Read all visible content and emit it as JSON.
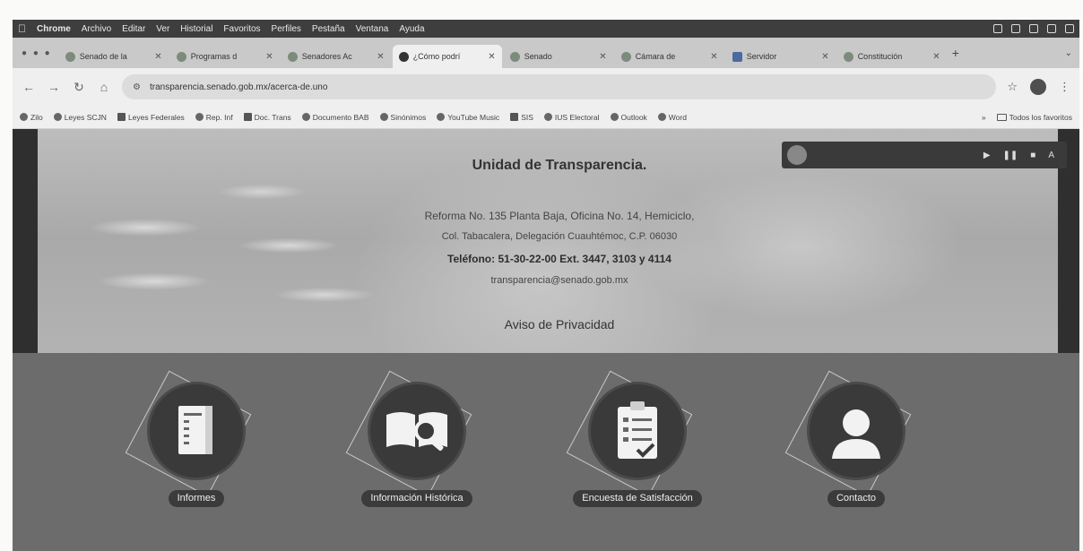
{
  "menubar": {
    "app": "Chrome",
    "items": [
      "Archivo",
      "Editar",
      "Ver",
      "Historial",
      "Favoritos",
      "Perfiles",
      "Pestaña",
      "Ventana",
      "Ayuda"
    ]
  },
  "tabs": [
    {
      "title": "Senado de la",
      "active": false
    },
    {
      "title": "Programas d",
      "active": false
    },
    {
      "title": "Senadores Ac",
      "active": false
    },
    {
      "title": "¿Cómo podrí",
      "active": true
    },
    {
      "title": "Senado",
      "active": false
    },
    {
      "title": "Cámara de",
      "active": false
    },
    {
      "title": "Servidor",
      "active": false
    },
    {
      "title": "Constitución",
      "active": false
    }
  ],
  "address": {
    "url": "transparencia.senado.gob.mx/acerca-de.uno"
  },
  "bookmarks": [
    "Zilo",
    "Leyes SCJN",
    "Leyes Federales",
    "Rep. Inf",
    "Doc. Trans",
    "Documento BAB",
    "Sinónimos",
    "YouTube Music",
    "SIS",
    "IUS Electoral",
    "Outlook",
    "Word"
  ],
  "bookmarks_all_label": "Todos los favoritos",
  "hero": {
    "title": "Unidad de Transparencia.",
    "line1": "Reforma No. 135 Planta Baja, Oficina No. 14, Hemiciclo,",
    "line2": "Col. Tabacalera, Delegación Cuauhtémoc, C.P. 06030",
    "line3": "Teléfono: 51-30-22-00 Ext. 3447, 3103 y 4114",
    "line4": "transparencia@senado.gob.mx",
    "privacy": "Aviso de Privacidad"
  },
  "cards": [
    {
      "label": "Informes",
      "icon": "book-icon"
    },
    {
      "label": "Información Histórica",
      "icon": "open-book-search-icon"
    },
    {
      "label": "Encuesta de Satisfacción",
      "icon": "clipboard-checklist-icon"
    },
    {
      "label": "Contacto",
      "icon": "headset-user-icon"
    }
  ]
}
